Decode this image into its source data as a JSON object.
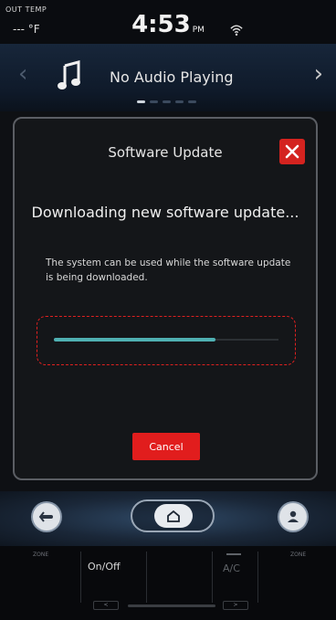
{
  "status_bar": {
    "out_temp_label": "OUT TEMP",
    "out_temp_value": "--- °F",
    "clock": "4:53",
    "clock_suffix": "PM"
  },
  "audio": {
    "label": "No Audio Playing",
    "prev_glyph": "‹",
    "next_glyph": "›",
    "page_count": 5,
    "active_page": 1
  },
  "dialog": {
    "title": "Software Update",
    "heading": "Downloading new software update...",
    "message": "The system can be used while the software update is being downloaded.",
    "progress_fraction": 0.72,
    "cancel_label": "Cancel",
    "close_icon": "close-icon"
  },
  "nav": {
    "left_icon": "left-nav-icon",
    "home_icon": "home-icon",
    "right_icon": "profile-icon"
  },
  "climate": {
    "left_label": "ZONE",
    "right_label": "ZONE",
    "onoff_label": "On/Off",
    "ac_label": "A/C",
    "fan_left_label": "< ",
    "fan_right_label": " >"
  },
  "colors": {
    "accent_red": "#e11d1d",
    "progress_teal": "#4fb0b2",
    "dialog_border": "#5b5e64"
  }
}
